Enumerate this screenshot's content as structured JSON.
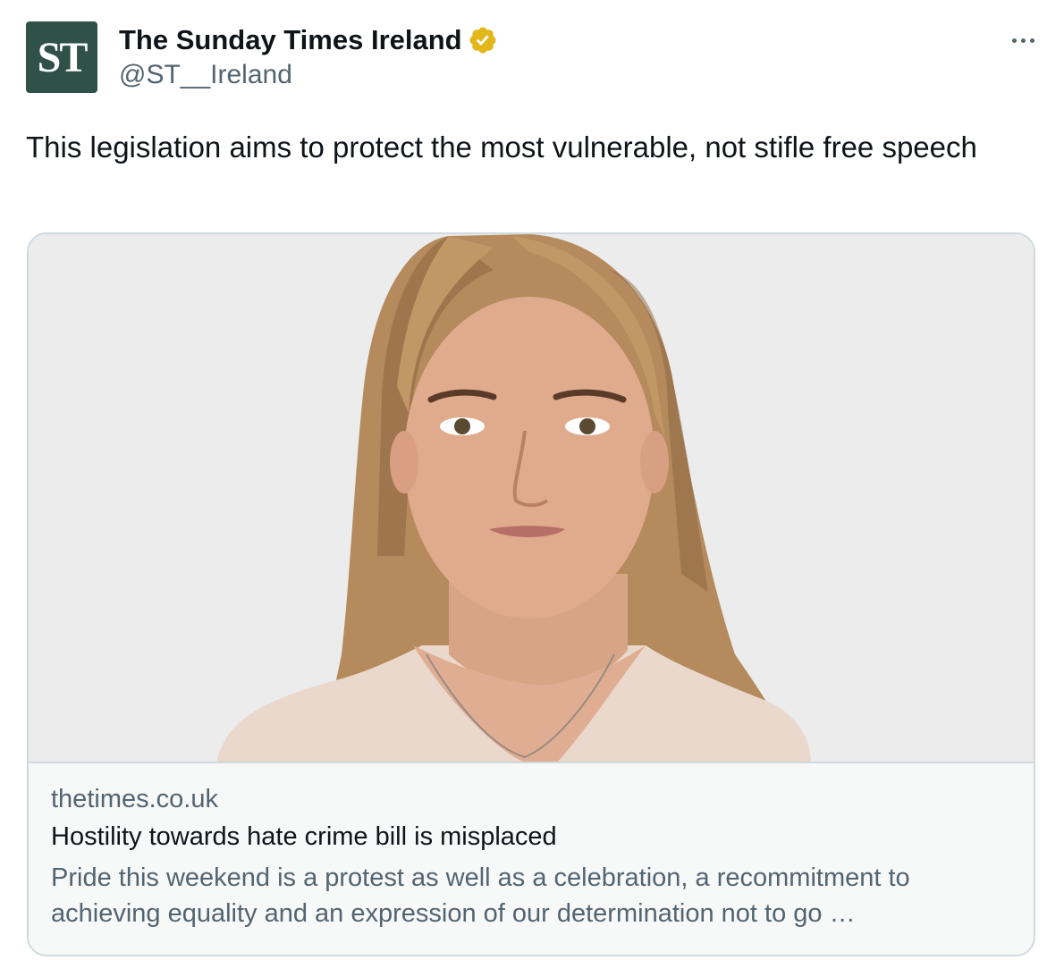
{
  "account": {
    "avatar_text": "ST",
    "display_name": "The Sunday Times Ireland",
    "handle": "@ST__Ireland",
    "verified": true,
    "avatar_color": "#2f5148",
    "verified_color": "#e2b719"
  },
  "tweet": {
    "text": "This legislation aims to protect the most vulnerable, not stifle free speech"
  },
  "card": {
    "image_icon": "portrait-photo",
    "domain": "thetimes.co.uk",
    "title": "Hostility towards hate crime bill is misplaced",
    "description": "Pride this weekend is a protest as well as a celebration, a recommitment to achieving equality and an expression of our determination not to go …"
  }
}
